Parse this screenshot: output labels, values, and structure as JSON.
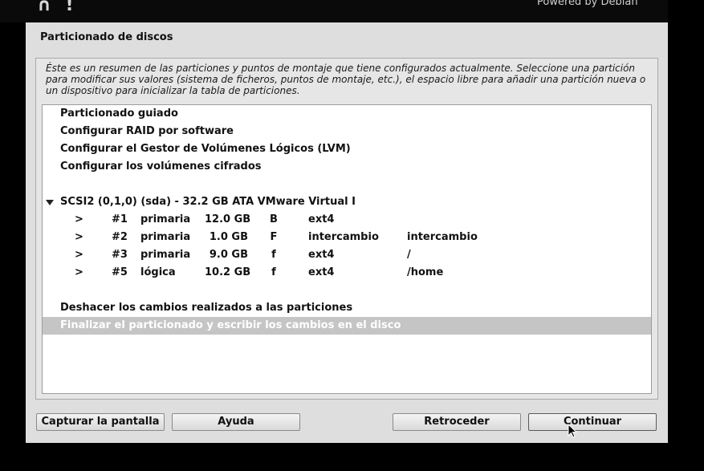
{
  "topbar": {
    "logo_fragment": "∩ !",
    "powered_by": "Powered by Debian"
  },
  "window": {
    "title": "Particionado de discos",
    "description": "Éste es un resumen de las particiones y puntos de montaje que tiene configurados actualmente. Seleccione una partición para modificar sus valores (sistema de ficheros, puntos de montaje, etc.), el espacio libre para añadir una partición nueva o un dispositivo para inicializar la tabla de particiones."
  },
  "list": {
    "options": [
      "Particionado guiado",
      "Configurar RAID por software",
      "Configurar el Gestor de Volúmenes Lógicos (LVM)",
      "Configurar los volúmenes cifrados"
    ],
    "disk_label": "SCSI2 (0,1,0) (sda) - 32.2 GB ATA VMware Virtual I",
    "partitions": [
      {
        "arrow": ">",
        "num": "#1",
        "type": "primaria",
        "size": "12.0 GB",
        "flag": "B",
        "fs": "ext4",
        "mount": ""
      },
      {
        "arrow": ">",
        "num": "#2",
        "type": "primaria",
        "size": "1.0 GB",
        "flag": "F",
        "fs": "intercambio",
        "mount": "intercambio"
      },
      {
        "arrow": ">",
        "num": "#3",
        "type": "primaria",
        "size": "9.0 GB",
        "flag": "f",
        "fs": "ext4",
        "mount": "/"
      },
      {
        "arrow": ">",
        "num": "#5",
        "type": "lógica",
        "size": "10.2 GB",
        "flag": "f",
        "fs": "ext4",
        "mount": "/home"
      }
    ],
    "undo_label": "Deshacer los cambios realizados a las particiones",
    "finish_label": "Finalizar el particionado y escribir los cambios en el disco",
    "selected_item": "finish"
  },
  "buttons": {
    "capture": "Capturar la pantalla",
    "help": "Ayuda",
    "back": "Retroceder",
    "continue": "Continuar"
  },
  "colors": {
    "selection": "#c5c5c5",
    "window_bg": "#dedede",
    "screen_bg": "#000000"
  }
}
